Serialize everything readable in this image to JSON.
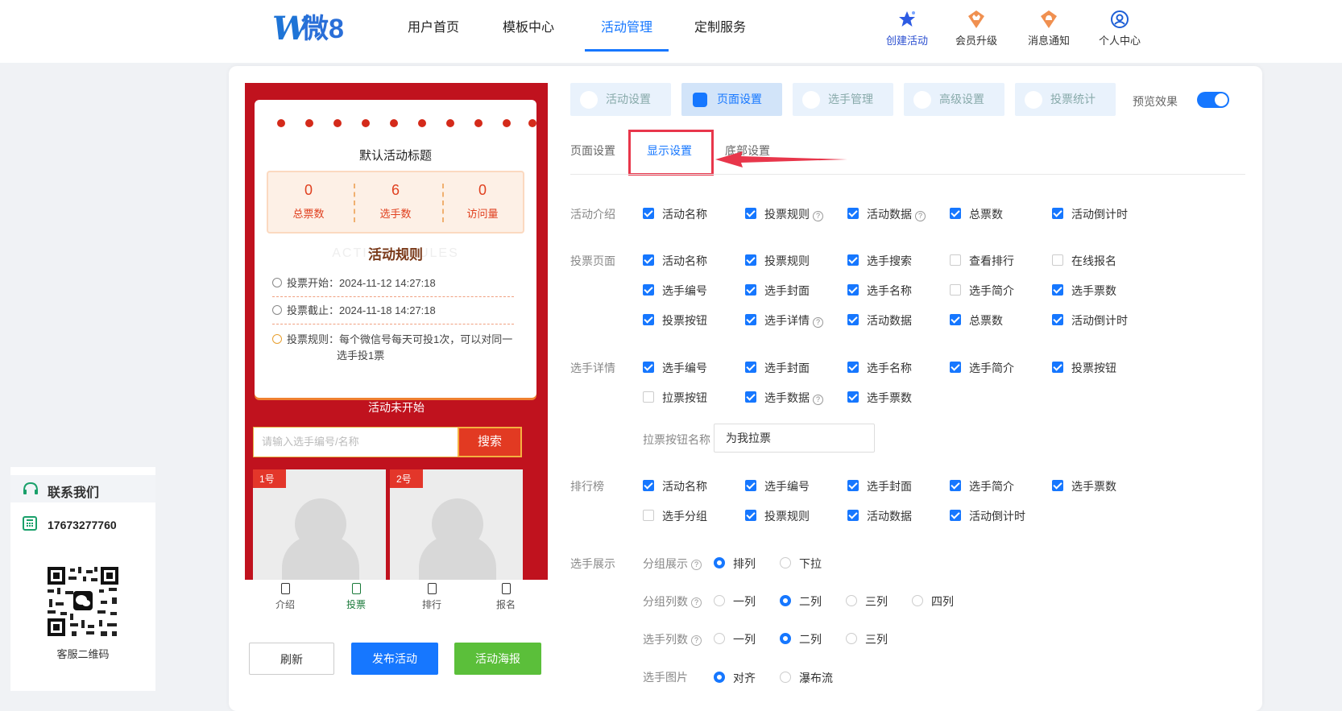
{
  "header": {
    "logo_w": "W",
    "logo_text": "微8",
    "nav": [
      "用户首页",
      "模板中心",
      "活动管理",
      "定制服务"
    ],
    "tools": [
      "创建活动",
      "会员升级",
      "消息通知",
      "个人中心"
    ]
  },
  "preview": {
    "title": "默认活动标题",
    "stats": [
      {
        "value": "0",
        "label": "总票数"
      },
      {
        "value": "6",
        "label": "选手数"
      },
      {
        "value": "0",
        "label": "访问量"
      }
    ],
    "rules_title": "活动规则",
    "rules_bg": "ACTIVITY RULES",
    "start": "投票开始：2024-11-12 14:27:18",
    "end": "投票截止：2024-11-18 14:27:18",
    "rule_line1": "投票规则：每个微信号每天可投1次，可以对同一",
    "rule_line2": "选手投1票",
    "status": "活动未开始",
    "search_placeholder": "请输入选手编号/名称",
    "search_btn": "搜索",
    "cards": [
      "1号",
      "2号"
    ],
    "tabs": [
      "介绍",
      "投票",
      "排行",
      "报名"
    ]
  },
  "buttons": {
    "refresh": "刷新",
    "publish": "发布活动",
    "poster": "活动海报"
  },
  "contact": {
    "title": "联系我们",
    "phone": "17673277760",
    "qr_caption": "客服二维码"
  },
  "settings_tabs": [
    "活动设置",
    "页面设置",
    "选手管理",
    "高级设置",
    "投票统计"
  ],
  "preview_label": "预览效果",
  "subtabs": [
    "页面设置",
    "显示设置",
    "底部设置"
  ],
  "sections": {
    "intro": {
      "label": "活动介绍",
      "items": [
        "活动名称",
        "投票规则",
        "活动数据",
        "总票数",
        "活动倒计时"
      ]
    },
    "vote": {
      "label": "投票页面",
      "items": [
        "活动名称",
        "投票规则",
        "选手搜索",
        "查看排行",
        "在线报名",
        "选手编号",
        "选手封面",
        "选手名称",
        "选手简介",
        "选手票数",
        "投票按钮",
        "选手详情",
        "活动数据",
        "总票数",
        "活动倒计时"
      ]
    },
    "detail": {
      "label": "选手详情",
      "items": [
        "选手编号",
        "选手封面",
        "选手名称",
        "选手简介",
        "投票按钮",
        "拉票按钮",
        "选手数据",
        "选手票数"
      ],
      "pull_label": "拉票按钮名称",
      "pull_value": "为我拉票"
    },
    "rank": {
      "label": "排行榜",
      "items": [
        "活动名称",
        "选手编号",
        "选手封面",
        "选手简介",
        "选手票数",
        "选手分组",
        "投票规则",
        "活动数据",
        "活动倒计时"
      ]
    },
    "display": {
      "label": "选手展示",
      "group_show": {
        "label": "分组展示",
        "options": [
          "排列",
          "下拉"
        ]
      },
      "group_cols": {
        "label": "分组列数",
        "options": [
          "一列",
          "二列",
          "三列",
          "四列"
        ]
      },
      "player_cols": {
        "label": "选手列数",
        "options": [
          "一列",
          "二列",
          "三列"
        ]
      },
      "player_img": {
        "label": "选手图片",
        "options": [
          "对齐",
          "瀑布流"
        ]
      }
    }
  }
}
